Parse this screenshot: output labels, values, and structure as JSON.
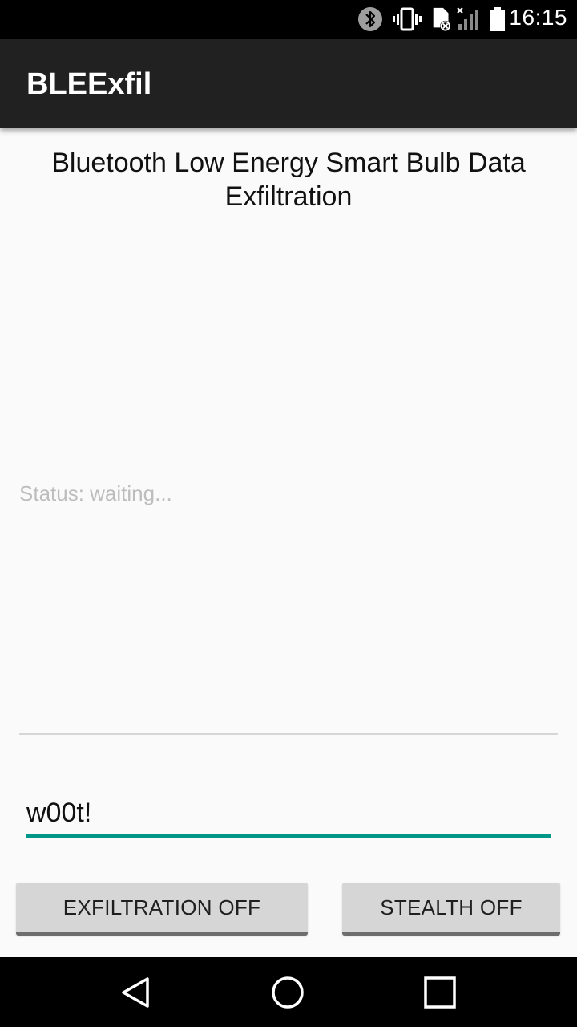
{
  "status_bar": {
    "time": "16:15",
    "icons": [
      "bluetooth-icon",
      "vibrate-icon",
      "sim-card-icon",
      "signal-icon",
      "battery-icon"
    ]
  },
  "app_bar": {
    "title": "BLEExfil"
  },
  "main": {
    "headline": "Bluetooth Low Energy Smart Bulb Data Exfiltration",
    "status": "Status: waiting...",
    "message_value": "w00t!",
    "buttons": {
      "exfiltration": "EXFILTRATION OFF",
      "stealth": "STEALTH OFF"
    }
  },
  "colors": {
    "accent": "#009688",
    "app_bar": "#212121",
    "background": "#fafafa",
    "button": "#d6d6d6"
  },
  "nav_bar": {
    "icons": [
      "back-icon",
      "home-icon",
      "recents-icon"
    ]
  }
}
